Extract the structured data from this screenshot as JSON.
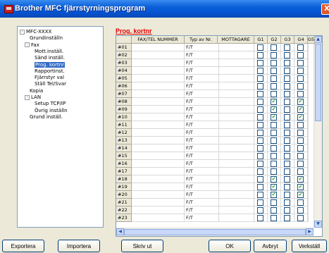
{
  "window": {
    "title": "Brother MFC fjärrstyrningsprogram",
    "close": "X"
  },
  "tree": [
    {
      "label": "MFC-XXXX",
      "toggle": "-",
      "indent": 0
    },
    {
      "label": "Grundinställn",
      "indent": 2
    },
    {
      "label": "Fax",
      "toggle": "-",
      "indent": 1
    },
    {
      "label": "Mott.inställ.",
      "indent": 3
    },
    {
      "label": "Sänd inställ.",
      "indent": 3
    },
    {
      "label": "Prog. kortnr",
      "indent": 3,
      "selected": true
    },
    {
      "label": "Rapportinst.",
      "indent": 3
    },
    {
      "label": "Fjärrstyr val",
      "indent": 3
    },
    {
      "label": "Ställ Tel/Svar",
      "indent": 3
    },
    {
      "label": "Kopia",
      "indent": 2
    },
    {
      "label": "LAN",
      "toggle": "-",
      "indent": 1
    },
    {
      "label": "Setup TCP/IP",
      "indent": 3
    },
    {
      "label": "Övrig inställn",
      "indent": 3
    },
    {
      "label": "Grund inställ.",
      "indent": 2
    }
  ],
  "panel_title": "Prog. kortnr",
  "columns": [
    "FAX/TEL NUMMER",
    "Typ av Nr.",
    "MOTTAGARE",
    "G1",
    "G2",
    "G3",
    "G4",
    "G5"
  ],
  "rows": [
    {
      "num": "#01",
      "type": "F/T",
      "g": [
        0,
        0,
        0,
        0,
        0
      ]
    },
    {
      "num": "#02",
      "type": "F/T",
      "g": [
        0,
        0,
        0,
        0,
        0
      ]
    },
    {
      "num": "#03",
      "type": "F/T",
      "g": [
        0,
        0,
        0,
        0,
        0
      ]
    },
    {
      "num": "#04",
      "type": "F/T",
      "g": [
        0,
        0,
        0,
        0,
        0
      ]
    },
    {
      "num": "#05",
      "type": "F/T",
      "g": [
        0,
        0,
        0,
        0,
        0
      ]
    },
    {
      "num": "#06",
      "type": "F/T",
      "g": [
        0,
        0,
        0,
        0,
        0
      ]
    },
    {
      "num": "#07",
      "type": "F/T",
      "g": [
        0,
        0,
        0,
        0,
        0
      ]
    },
    {
      "num": "#08",
      "type": "F/T",
      "g": [
        0,
        1,
        0,
        1,
        0
      ]
    },
    {
      "num": "#09",
      "type": "F/T",
      "g": [
        0,
        1,
        0,
        1,
        0
      ]
    },
    {
      "num": "#10",
      "type": "F/T",
      "g": [
        0,
        1,
        0,
        1,
        0
      ]
    },
    {
      "num": "#11",
      "type": "F/T",
      "g": [
        0,
        0,
        0,
        0,
        0
      ]
    },
    {
      "num": "#12",
      "type": "F/T",
      "g": [
        0,
        0,
        0,
        0,
        0
      ]
    },
    {
      "num": "#13",
      "type": "F/T",
      "g": [
        0,
        0,
        0,
        0,
        0
      ]
    },
    {
      "num": "#14",
      "type": "F/T",
      "g": [
        0,
        0,
        0,
        0,
        0
      ]
    },
    {
      "num": "#15",
      "type": "F/T",
      "g": [
        0,
        0,
        0,
        0,
        0
      ]
    },
    {
      "num": "#16",
      "type": "F/T",
      "g": [
        0,
        0,
        0,
        0,
        0
      ]
    },
    {
      "num": "#17",
      "type": "F/T",
      "g": [
        0,
        0,
        0,
        0,
        0
      ]
    },
    {
      "num": "#18",
      "type": "F/T",
      "g": [
        0,
        1,
        0,
        1,
        0
      ]
    },
    {
      "num": "#19",
      "type": "F/T",
      "g": [
        0,
        1,
        0,
        1,
        0
      ]
    },
    {
      "num": "#20",
      "type": "F/T",
      "g": [
        0,
        1,
        0,
        1,
        0
      ]
    },
    {
      "num": "#21",
      "type": "F/T",
      "g": [
        0,
        0,
        0,
        0,
        0
      ]
    },
    {
      "num": "#22",
      "type": "F/T",
      "g": [
        0,
        0,
        0,
        0,
        0
      ]
    },
    {
      "num": "#23",
      "type": "F/T",
      "g": [
        0,
        0,
        0,
        0,
        0
      ]
    }
  ],
  "scroll_glyphs": {
    "up": "▲",
    "down": "▼",
    "left": "◀",
    "right": "▶"
  },
  "buttons": {
    "export": "Exportera",
    "import": "Importera",
    "print": "Skriv ut",
    "ok": "OK",
    "cancel": "Avbryt",
    "apply": "Verkställ"
  }
}
